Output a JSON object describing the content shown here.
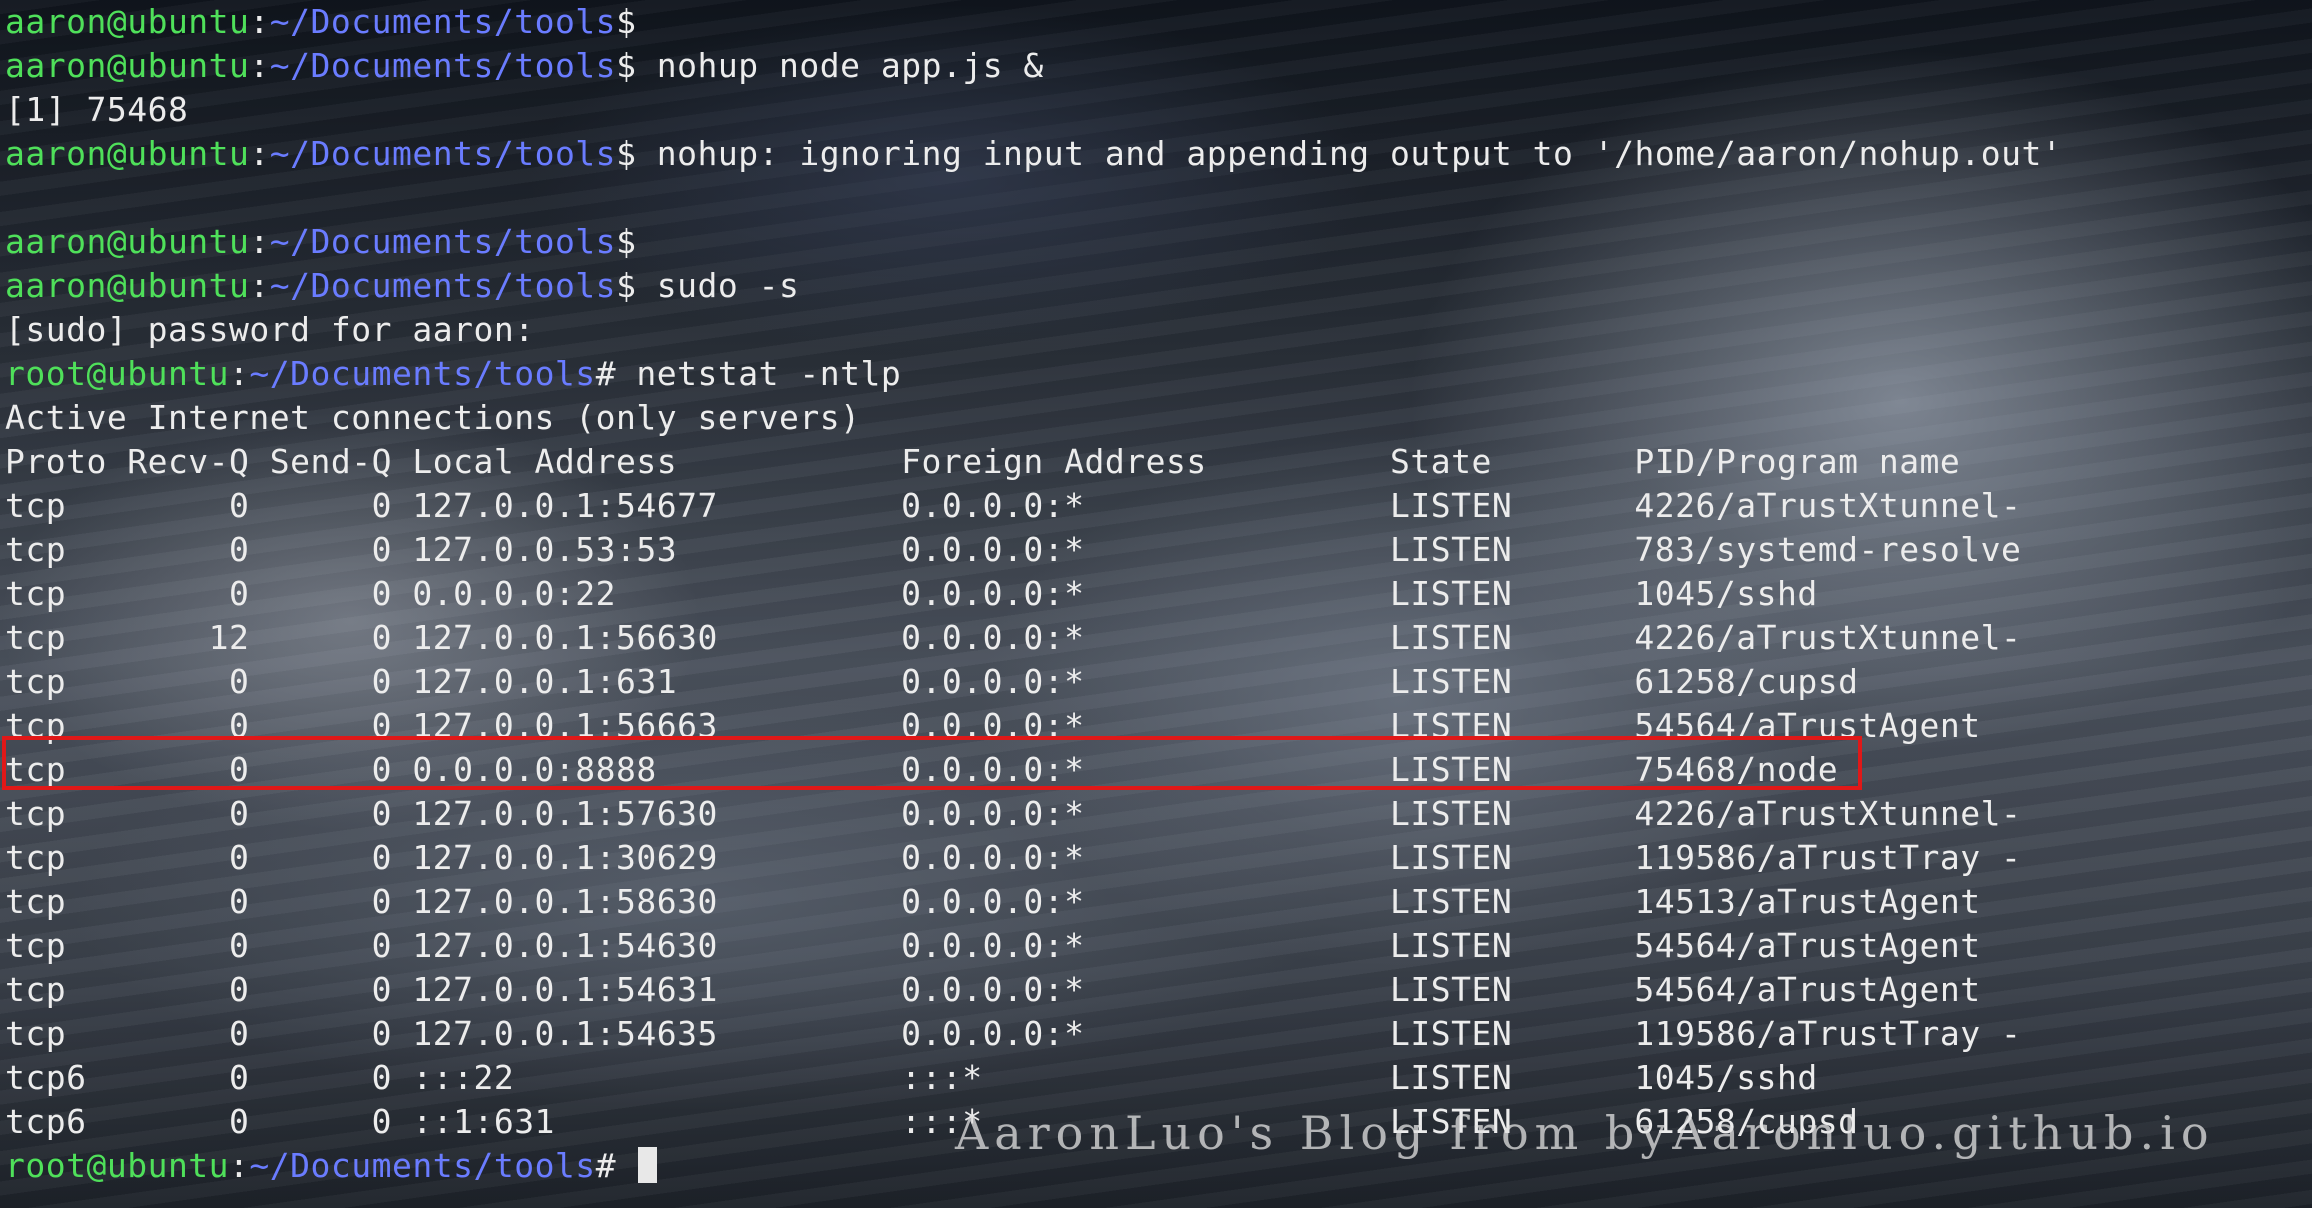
{
  "terminal": {
    "prompt_user": "aaron@ubuntu",
    "prompt_root": "root@ubuntu",
    "prompt_path": "~/Documents/tools",
    "lines": [
      {
        "type": "prompt",
        "who": "user",
        "cmd": ""
      },
      {
        "type": "prompt",
        "who": "user",
        "cmd": " nohup node app.js &"
      },
      {
        "type": "output",
        "text": "[1] 75468"
      },
      {
        "type": "prompt",
        "who": "user",
        "cmd": " nohup: ignoring input and appending output to '/home/aaron/nohup.out'"
      },
      {
        "type": "output",
        "text": ""
      },
      {
        "type": "prompt",
        "who": "user",
        "cmd": ""
      },
      {
        "type": "prompt",
        "who": "user",
        "cmd": " sudo -s"
      },
      {
        "type": "output",
        "text": "[sudo] password for aaron:"
      },
      {
        "type": "prompt",
        "who": "root",
        "cmd": " netstat -ntlp"
      },
      {
        "type": "output",
        "text": "Active Internet connections (only servers)"
      }
    ],
    "netstat": {
      "header": "Proto Recv-Q Send-Q Local Address           Foreign Address         State       PID/Program name",
      "rows": [
        "tcp        0      0 127.0.0.1:54677         0.0.0.0:*               LISTEN      4226/aTrustXtunnel-",
        "tcp        0      0 127.0.0.53:53           0.0.0.0:*               LISTEN      783/systemd-resolve",
        "tcp        0      0 0.0.0.0:22              0.0.0.0:*               LISTEN      1045/sshd",
        "tcp       12      0 127.0.0.1:56630         0.0.0.0:*               LISTEN      4226/aTrustXtunnel-",
        "tcp        0      0 127.0.0.1:631           0.0.0.0:*               LISTEN      61258/cupsd",
        "tcp        0      0 127.0.0.1:56663         0.0.0.0:*               LISTEN      54564/aTrustAgent",
        "tcp        0      0 0.0.0.0:8888            0.0.0.0:*               LISTEN      75468/node",
        "tcp        0      0 127.0.0.1:57630         0.0.0.0:*               LISTEN      4226/aTrustXtunnel-",
        "tcp        0      0 127.0.0.1:30629         0.0.0.0:*               LISTEN      119586/aTrustTray -",
        "tcp        0      0 127.0.0.1:58630         0.0.0.0:*               LISTEN      14513/aTrustAgent",
        "tcp        0      0 127.0.0.1:54630         0.0.0.0:*               LISTEN      54564/aTrustAgent",
        "tcp        0      0 127.0.0.1:54631         0.0.0.0:*               LISTEN      54564/aTrustAgent",
        "tcp        0      0 127.0.0.1:54635         0.0.0.0:*               LISTEN      119586/aTrustTray -",
        "tcp6       0      0 :::22                   :::*                    LISTEN      1045/sshd",
        "tcp6       0      0 ::1:631                 :::*                    LISTEN      61258/cupsd"
      ],
      "highlighted_row": 6
    },
    "final_prompt_who": "root"
  },
  "watermark": "AaronLuo's Blog from byAaronluo.github.io",
  "colors": {
    "prompt_user": "#4fe05a",
    "prompt_path": "#6a7cff",
    "text": "#ececec",
    "highlight": "#e01818"
  }
}
